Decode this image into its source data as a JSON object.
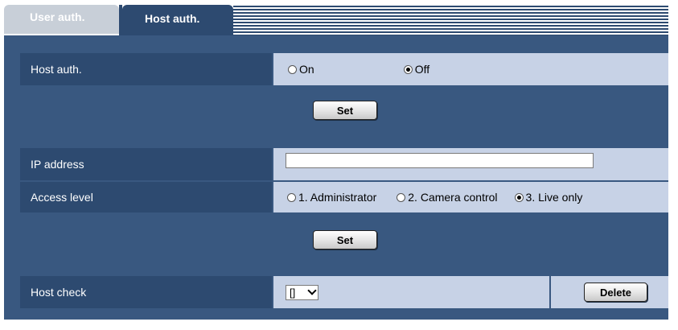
{
  "tabs": [
    {
      "label": "User auth.",
      "active": false
    },
    {
      "label": "Host auth.",
      "active": true
    }
  ],
  "host_auth": {
    "label": "Host auth.",
    "options": [
      {
        "label": "On",
        "checked": false
      },
      {
        "label": "Off",
        "checked": true
      }
    ],
    "set_label": "Set"
  },
  "ip_address": {
    "label": "IP address",
    "value": ""
  },
  "access_level": {
    "label": "Access level",
    "options": [
      {
        "label": "1. Administrator",
        "checked": false
      },
      {
        "label": "2. Camera control",
        "checked": false
      },
      {
        "label": "3. Live only",
        "checked": true
      }
    ],
    "set_label": "Set"
  },
  "host_check": {
    "label": "Host check",
    "selected": "[]",
    "delete_label": "Delete"
  },
  "colors": {
    "panel_bg": "#395880",
    "label_bg": "#2d4a70",
    "value_bg": "#c7d2e6",
    "inactive_tab": "#c8cfd8"
  }
}
